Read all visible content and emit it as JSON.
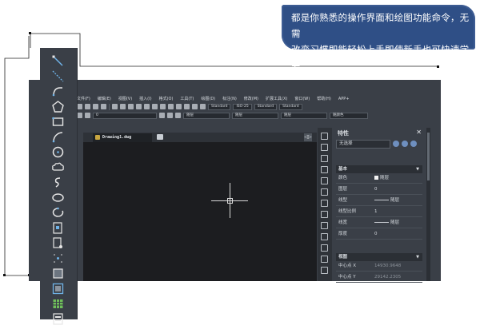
{
  "banner": {
    "line1": "都是你熟悉的操作界面和绘图功能命令，无需",
    "line2": "改变习惯即能轻松上手即使新手也可快速学会"
  },
  "menu": [
    "文件(F)",
    "编辑(E)",
    "视图(V)",
    "插入(I)",
    "格式(O)",
    "工具(T)",
    "绘图(D)",
    "标注(N)",
    "修改(M)",
    "扩展工具(X)",
    "窗口(W)",
    "帮助(H)",
    "APP+"
  ],
  "toolbar1": {
    "text_style": "Standard",
    "dim_style": "ISO-25",
    "table_style": "Standard",
    "multileader_style": "Standard"
  },
  "toolbar2": {
    "layer": "0",
    "color": "随层",
    "linetype": "随层",
    "lineweight": "随层",
    "plotstyle": "随颜色"
  },
  "drawing_tab": "Drawing1.dwg",
  "collapse_glyph": "◁▷",
  "properties": {
    "title": "特性",
    "close": "✕",
    "selection": "无选择",
    "section_basic": "基本",
    "rows": [
      {
        "key": "颜色",
        "value": "随层"
      },
      {
        "key": "图层",
        "value": "0"
      },
      {
        "key": "线型",
        "value": "随层"
      },
      {
        "key": "线型比例",
        "value": "1"
      },
      {
        "key": "线宽",
        "value": "随层"
      },
      {
        "key": "厚度",
        "value": "0"
      }
    ],
    "section_view": "视图",
    "view_rows": [
      {
        "key": "中心点 X",
        "value": "14930.9648"
      },
      {
        "key": "中心点 Y",
        "value": "29142.2305"
      }
    ]
  },
  "left_tools": [
    "line-icon",
    "construction-line-icon",
    "polyline-icon",
    "polygon-icon",
    "rectangle-icon",
    "arc-icon",
    "circle-icon",
    "revision-cloud-icon",
    "spline-icon",
    "ellipse-icon",
    "ellipse-arc-icon",
    "insert-block-icon",
    "make-block-icon",
    "point-icon",
    "hatch-icon",
    "region-icon",
    "table-icon",
    "mtext-icon"
  ],
  "colors": {
    "banner": "#2f4f86",
    "app_bg": "#3a3f47",
    "canvas": "#1c1d20"
  }
}
